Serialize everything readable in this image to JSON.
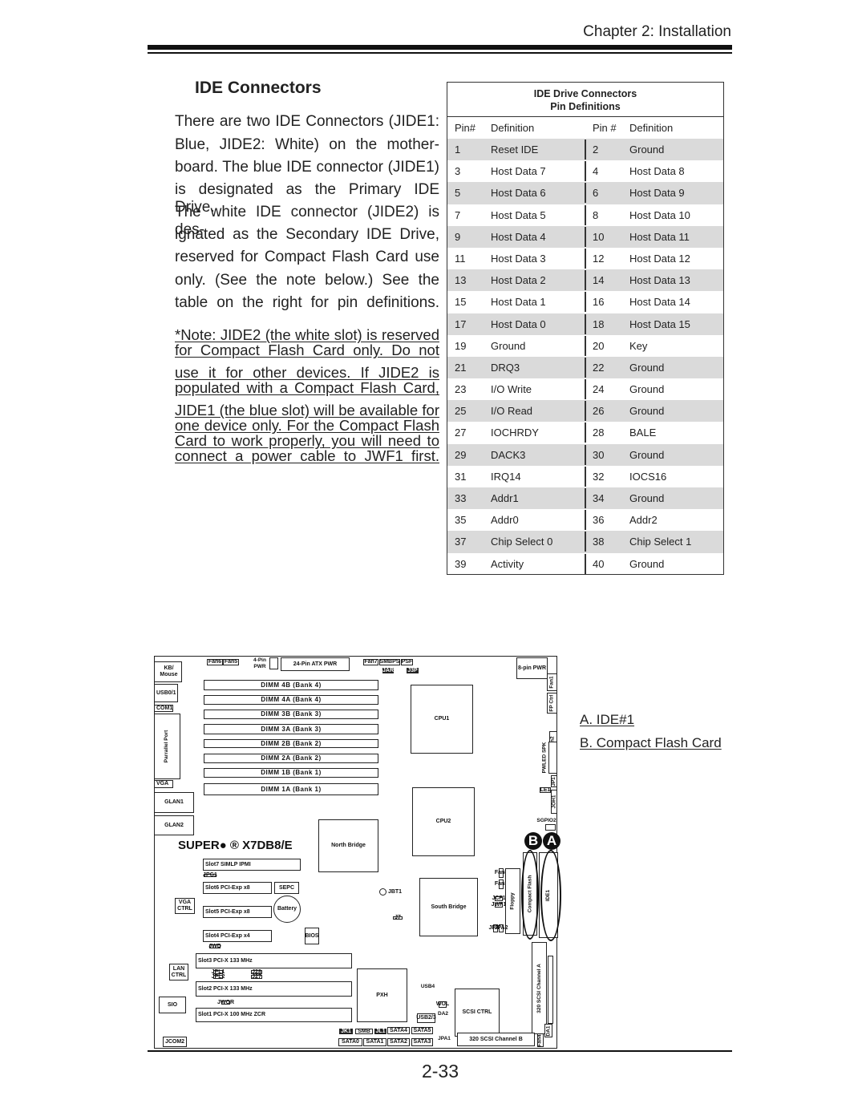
{
  "header": {
    "chapter": "Chapter 2: Installation"
  },
  "section": {
    "title": "IDE Connectors",
    "paragraph_lines": [
      "There are two IDE Connectors (JIDE1:",
      "Blue, JIDE2: White) on the mother-",
      "board. The blue IDE connector (JIDE1)",
      "is designated as the Primary  IDE Drive.",
      "The white IDE connector (JIDE2) is des-",
      "ignated as the Secondary IDE Drive,",
      "reserved for Compact Flash Card use",
      "only. (See the note below.) See the",
      "table on the right for pin definitions."
    ],
    "note_lines": [
      "*Note: JIDE2 (the white slot) is reserved",
      "for Compact Flash Card only. Do not",
      "use it for other devices. If JIDE2 is",
      "populated with a Compact Flash Card,",
      "JIDE1 (the blue slot) will be available for",
      "one device only. For the Compact Flash",
      "Card to work properly, you will need to",
      "connect a power cable to JWF1 first."
    ]
  },
  "pin_table": {
    "title_line1": "IDE Drive Connectors",
    "title_line2": "Pin Definitions",
    "columns": [
      "Pin#",
      "Definition",
      "Pin #",
      "Definition"
    ],
    "rows": [
      [
        "1",
        "Reset IDE",
        "2",
        "Ground"
      ],
      [
        "3",
        "Host Data 7",
        "4",
        "Host Data 8"
      ],
      [
        "5",
        "Host Data 6",
        "6",
        "Host Data 9"
      ],
      [
        "7",
        "Host Data 5",
        "8",
        "Host Data 10"
      ],
      [
        "9",
        "Host Data 4",
        "10",
        "Host Data 11"
      ],
      [
        "11",
        "Host Data 3",
        "12",
        "Host Data 12"
      ],
      [
        "13",
        "Host Data 2",
        "14",
        "Host Data 13"
      ],
      [
        "15",
        "Host Data 1",
        "16",
        "Host Data 14"
      ],
      [
        "17",
        "Host Data 0",
        "18",
        "Host Data 15"
      ],
      [
        "19",
        "Ground",
        "20",
        "Key"
      ],
      [
        "21",
        "DRQ3",
        "22",
        "Ground"
      ],
      [
        "23",
        "I/O Write",
        "24",
        "Ground"
      ],
      [
        "25",
        "I/O Read",
        "26",
        "Ground"
      ],
      [
        "27",
        "IOCHRDY",
        "28",
        "BALE"
      ],
      [
        "29",
        "DACK3",
        "30",
        "Ground"
      ],
      [
        "31",
        "IRQ14",
        "32",
        "IOCS16"
      ],
      [
        "33",
        "Addr1",
        "34",
        "Ground"
      ],
      [
        "35",
        "Addr0",
        "36",
        "Addr2"
      ],
      [
        "37",
        "Chip Select 0",
        "38",
        "Chip Select 1"
      ],
      [
        "39",
        "Activity",
        "40",
        "Ground"
      ]
    ],
    "shade_color": "#dadada"
  },
  "diagram": {
    "brand": "SUPER● ® X7DB8/E",
    "marker_a": "A",
    "marker_b": "B",
    "labels": {
      "kb": "KB/ Mouse",
      "usb01": "USB0/1",
      "com1": "COM1",
      "parallel": "Parrallel Port",
      "vga": "VGA",
      "glan1": "GLAN1",
      "glan2": "GLAN2",
      "fan6": "Fan6",
      "fan5": "Fan5",
      "pin4": "4-Pin PWR",
      "atx": "24-Pin ATX PWR",
      "fan7": "Fan7",
      "smbps": "SMBPS",
      "psf": "PSF",
      "jar": "JAR",
      "j3p": "J3P",
      "pin8": "8-pin PWR",
      "fan1": "Fan1",
      "fpctrl": "FP Ctrl",
      "fan2": "Fan2",
      "pwled": "PWLED SPK",
      "jp1": "JP1",
      "le1": "LE1",
      "joh1": "JOH1",
      "sgpio2": "SGPIO2",
      "dimm4b": "DIMM 4B (Bank 4)",
      "dimm4a": "DIMM 4A (Bank 4)",
      "dimm3b": "DIMM 3B (Bank 3)",
      "dimm3a": "DIMM 3A (Bank 3)",
      "dimm2b": "DIMM 2B (Bank 2)",
      "dimm2a": "DIMM 2A (Bank 2)",
      "dimm1b": "DIMM 1B (Bank 1)",
      "dimm1a": "DIMM 1A (Bank 1)",
      "cpu1": "CPU1",
      "cpu2": "CPU2",
      "nb": "North Bridge",
      "slot7": "Slot7   SIMLP IPMI",
      "jpg1": "JPG1",
      "slot6": "Slot6   PCI-Exp x8",
      "sepc": "SEPC",
      "battery": "Battery",
      "slot5": "Slot5   PCI-Exp x8",
      "vgactrl": "VGA CTRL",
      "slot4": "Slot4   PCI-Exp x4",
      "bios": "BIOS",
      "jwd": "JWD",
      "slot3": "Slot3   PCI-X 133 MHz",
      "lanctrl": "LAN CTRL",
      "jpl1": "JPL1",
      "jpl2": "JPL2",
      "j28": "J28",
      "j27": "J27",
      "slot2": "Slot2   PCI-X 133 MHz",
      "sio": "SIO",
      "jwor": "JWOR",
      "slot1": "Slot1   PCI-X 100 MHz  ZCR",
      "jcom2": "JCOM2",
      "pxh": "PXH",
      "j7": "J7",
      "jbt1": "JBT1",
      "sb": "South Bridge",
      "jcf1": "JCF1",
      "jwf1": "JWF1",
      "fan8": "Fan8",
      "fan3": "Fan3",
      "floppy": "Floppy",
      "cf": "Compact Flash",
      "ide1": "IDE1",
      "jpa3": "JPA3",
      "jpa2": "JPA2",
      "scsia": "320 SCSI  Channel  A",
      "usb4": "USB4",
      "scsictrl": "SCSI CTRL",
      "wol": "WOL",
      "usb23": "USB2/3",
      "da2": "DA2",
      "sata4": "SATA4",
      "sata5": "SATA5",
      "sata0": "SATA0",
      "sata1": "SATA1",
      "sata2": "SATA2",
      "sata3": "SATA3",
      "jk1": "JK1",
      "smb": "SMB",
      "jl1": "JL1",
      "jpa1": "JPA1",
      "scsib": "320 SCSI  Channel  B",
      "fan4": "Fan4",
      "da1": "DA1"
    }
  },
  "legend": {
    "a": "A. IDE#1",
    "b": "B. Compact Flash Card"
  },
  "footer": {
    "page_number": "2-33"
  }
}
